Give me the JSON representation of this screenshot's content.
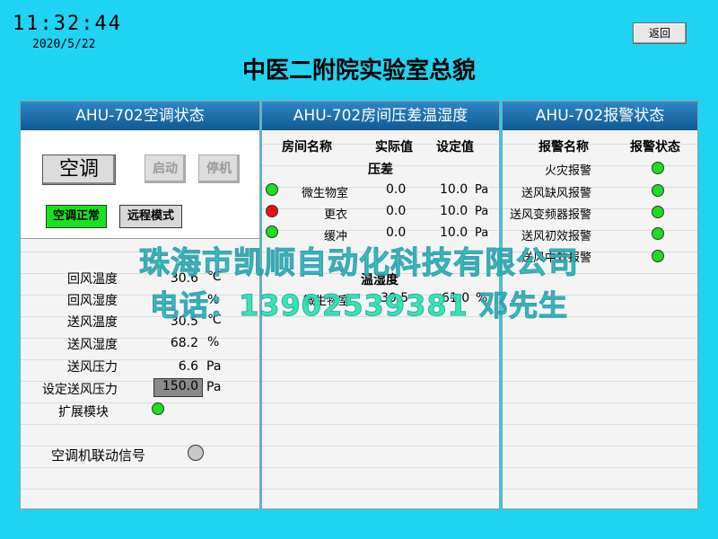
{
  "header": {
    "time": "11:32:44",
    "date": "2020/5/22",
    "back_label": "返回",
    "title": "中医二附院实验室总貌"
  },
  "ac_panel": {
    "title": "AHU-702空调状态",
    "ac_label": "空调",
    "start_label": "启动",
    "stop_label": "停机",
    "status_normal": "空调正常",
    "status_mode": "远程模式",
    "rows": [
      {
        "label": "回风温度",
        "value": "30.6",
        "unit": "℃"
      },
      {
        "label": "回风湿度",
        "value": "",
        "unit": "%"
      },
      {
        "label": "送风温度",
        "value": "30.5",
        "unit": "℃"
      },
      {
        "label": "送风湿度",
        "value": "68.2",
        "unit": "%"
      },
      {
        "label": "送风压力",
        "value": "6.6",
        "unit": "Pa"
      },
      {
        "label": "设定送风压力",
        "value": "150.0",
        "unit": "Pa"
      },
      {
        "label": "扩展模块",
        "value": "",
        "unit": ""
      }
    ],
    "link_signal_label": "空调机联动信号"
  },
  "room_panel": {
    "title": "AHU-702房间压差温湿度",
    "col_room": "房间名称",
    "col_actual": "实际值",
    "col_setpoint": "设定值",
    "pressure_section": "压差",
    "pressure_rows": [
      {
        "room": "微生物室",
        "actual": "0.0",
        "setpoint": "10.0",
        "unit": "Pa",
        "status": "green"
      },
      {
        "room": "更衣",
        "actual": "0.0",
        "setpoint": "10.0",
        "unit": "Pa",
        "status": "red"
      },
      {
        "room": "缓冲",
        "actual": "0.0",
        "setpoint": "10.0",
        "unit": "Pa",
        "status": "green"
      }
    ],
    "th_section": "温湿度",
    "th_rows": [
      {
        "room": "微生物室",
        "temp": "30.5",
        "hum": "61.0",
        "unit": "%"
      }
    ]
  },
  "alarm_panel": {
    "title": "AHU-702报警状态",
    "col_name": "报警名称",
    "col_status": "报警状态",
    "alarms": [
      {
        "name": "火灾报警",
        "status": "green"
      },
      {
        "name": "送风缺风报警",
        "status": "green"
      },
      {
        "name": "送风变频器报警",
        "status": "green"
      },
      {
        "name": "送风初效报警",
        "status": "green"
      },
      {
        "name": "送风中效报警",
        "status": "green"
      }
    ]
  },
  "watermark": {
    "line1": "珠海市凯顺自动化科技有限公司",
    "line2": "电话：13902539381 邓先生"
  }
}
